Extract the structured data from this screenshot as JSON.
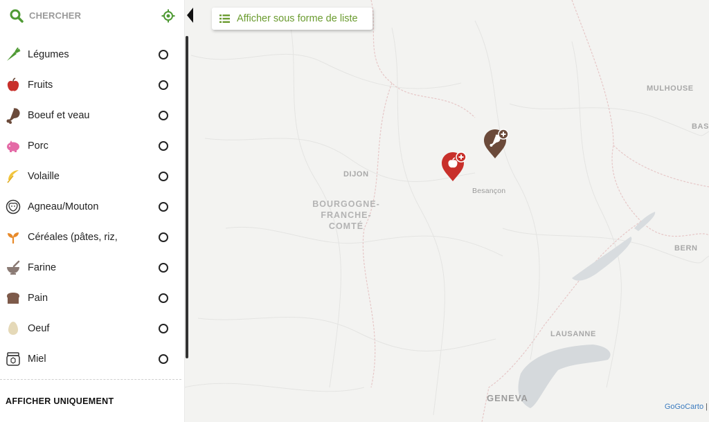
{
  "search": {
    "label": "CHERCHER"
  },
  "categories": [
    {
      "name": "Légumes",
      "icon": "carrot-icon",
      "color": "#4f9a34"
    },
    {
      "name": "Fruits",
      "icon": "apple-icon",
      "color": "#c8302b"
    },
    {
      "name": "Boeuf et veau",
      "icon": "meat-leg-icon",
      "color": "#6b4a3a"
    },
    {
      "name": "Porc",
      "icon": "piggy-icon",
      "color": "#e46aa6"
    },
    {
      "name": "Volaille",
      "icon": "feather-icon",
      "color": "#f2c53d"
    },
    {
      "name": "Agneau/Mouton",
      "icon": "sheep-icon",
      "color": "#333333"
    },
    {
      "name": "Céréales (pâtes, riz,",
      "icon": "sprout-icon",
      "color": "#e88a2a"
    },
    {
      "name": "Farine",
      "icon": "mortar-icon",
      "color": "#8a7a74"
    },
    {
      "name": "Pain",
      "icon": "bread-icon",
      "color": "#7d5a4a"
    },
    {
      "name": "Oeuf",
      "icon": "egg-icon",
      "color": "#e5d9b8"
    },
    {
      "name": "Miel",
      "icon": "honey-jar-icon",
      "color": "#333333"
    }
  ],
  "only_section": {
    "title": "AFFICHER UNIQUEMENT"
  },
  "list_button": {
    "label": "Afficher sous forme de liste"
  },
  "map": {
    "labels": {
      "dijon": "DIJON",
      "region_1": "BOURGOGNE-",
      "region_2": "FRANCHE-",
      "region_3": "COMTÉ",
      "besancon": "Besançon",
      "mulhouse": "MULHOUSE",
      "basel": "BAS",
      "bern": "BERN",
      "lausanne": "LAUSANNE",
      "geneva": "GENEVA"
    },
    "markers": [
      {
        "category": "Fruits",
        "color": "#c8302b"
      },
      {
        "category": "Boeuf et veau",
        "color": "#6b4a3a"
      }
    ]
  },
  "attribution": {
    "text": "GoGoCarto",
    "separator": "|"
  },
  "colors": {
    "accent": "#6a9b2f",
    "icon_green": "#4f9a34"
  }
}
